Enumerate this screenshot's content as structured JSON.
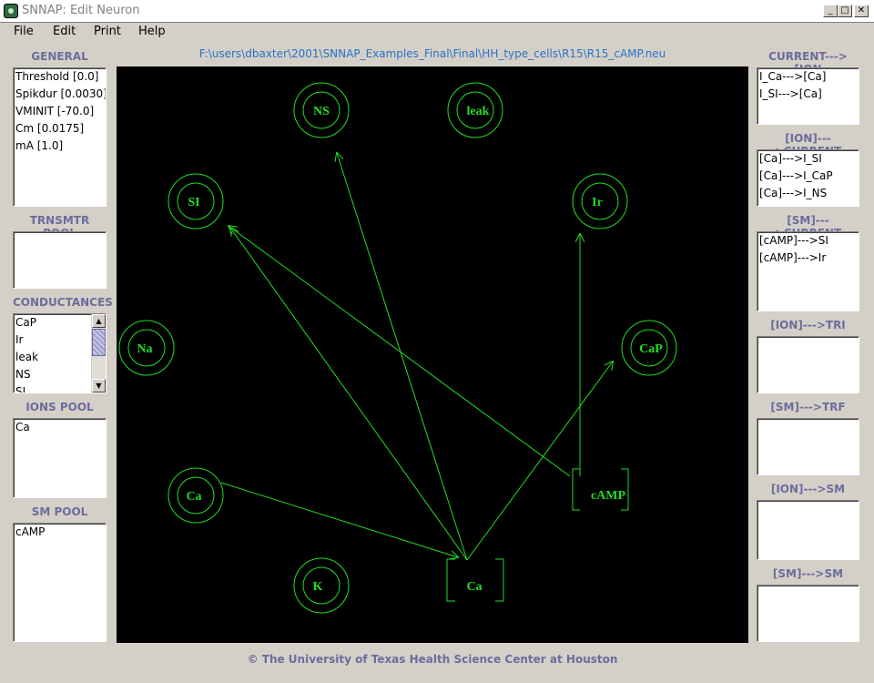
{
  "window": {
    "title": "SNNAP:  Edit Neuron",
    "minimize_label": "_",
    "maximize_label": "□",
    "close_label": "✕"
  },
  "menu": [
    "File",
    "Edit",
    "Print",
    "Help"
  ],
  "filepath": "F:\\users\\dbaxter\\2001\\SNNAP_Examples_Final\\Final\\HH_type_cells\\R15\\R15_cAMP.neu",
  "left": {
    "general": {
      "label": "GENERAL",
      "items": [
        "Threshold [0.0]",
        "Spikdur [0.0030]",
        "VMINIT [-70.0]",
        "Cm [0.0175]",
        "mA [1.0]"
      ]
    },
    "trnsmtr_pool": {
      "label": "TRNSMTR POOL",
      "items": []
    },
    "conductances": {
      "label": "CONDUCTANCES",
      "items": [
        "CaP",
        "Ir",
        "leak",
        "NS",
        "SI"
      ],
      "scroll_up": "▲",
      "scroll_down": "▼"
    },
    "ions_pool": {
      "label": "IONS POOL",
      "items": [
        "Ca"
      ]
    },
    "sm_pool": {
      "label": "SM POOL",
      "items": [
        "cAMP"
      ]
    }
  },
  "right": {
    "current_ion": {
      "label": "CURRENT--->[ION",
      "items": [
        "I_Ca--->[Ca]",
        "I_SI--->[Ca]"
      ]
    },
    "ion_current": {
      "label": "[ION]--->CURRENT",
      "items": [
        "[Ca]--->I_SI",
        "[Ca]--->I_CaP",
        "[Ca]--->I_NS"
      ]
    },
    "sm_current": {
      "label": "[SM]--->CURRENT",
      "items": [
        "[cAMP]--->SI",
        "[cAMP]--->Ir"
      ]
    },
    "ion_tri": {
      "label": "[ION]--->TRI",
      "items": []
    },
    "sm_trf": {
      "label": "[SM]--->TRF",
      "items": []
    },
    "ion_sm": {
      "label": "[ION]--->SM",
      "items": []
    },
    "sm_sm": {
      "label": "[SM]--->SM",
      "items": []
    }
  },
  "diagram": {
    "color": "#22dd22",
    "conductances": [
      "NS",
      "leak",
      "SI",
      "Ir",
      "Na",
      "CaP",
      "Ca",
      "K"
    ],
    "pools": [
      "cAMP",
      "Ca"
    ]
  },
  "footer": "© The University of Texas Health Science Center at Houston"
}
